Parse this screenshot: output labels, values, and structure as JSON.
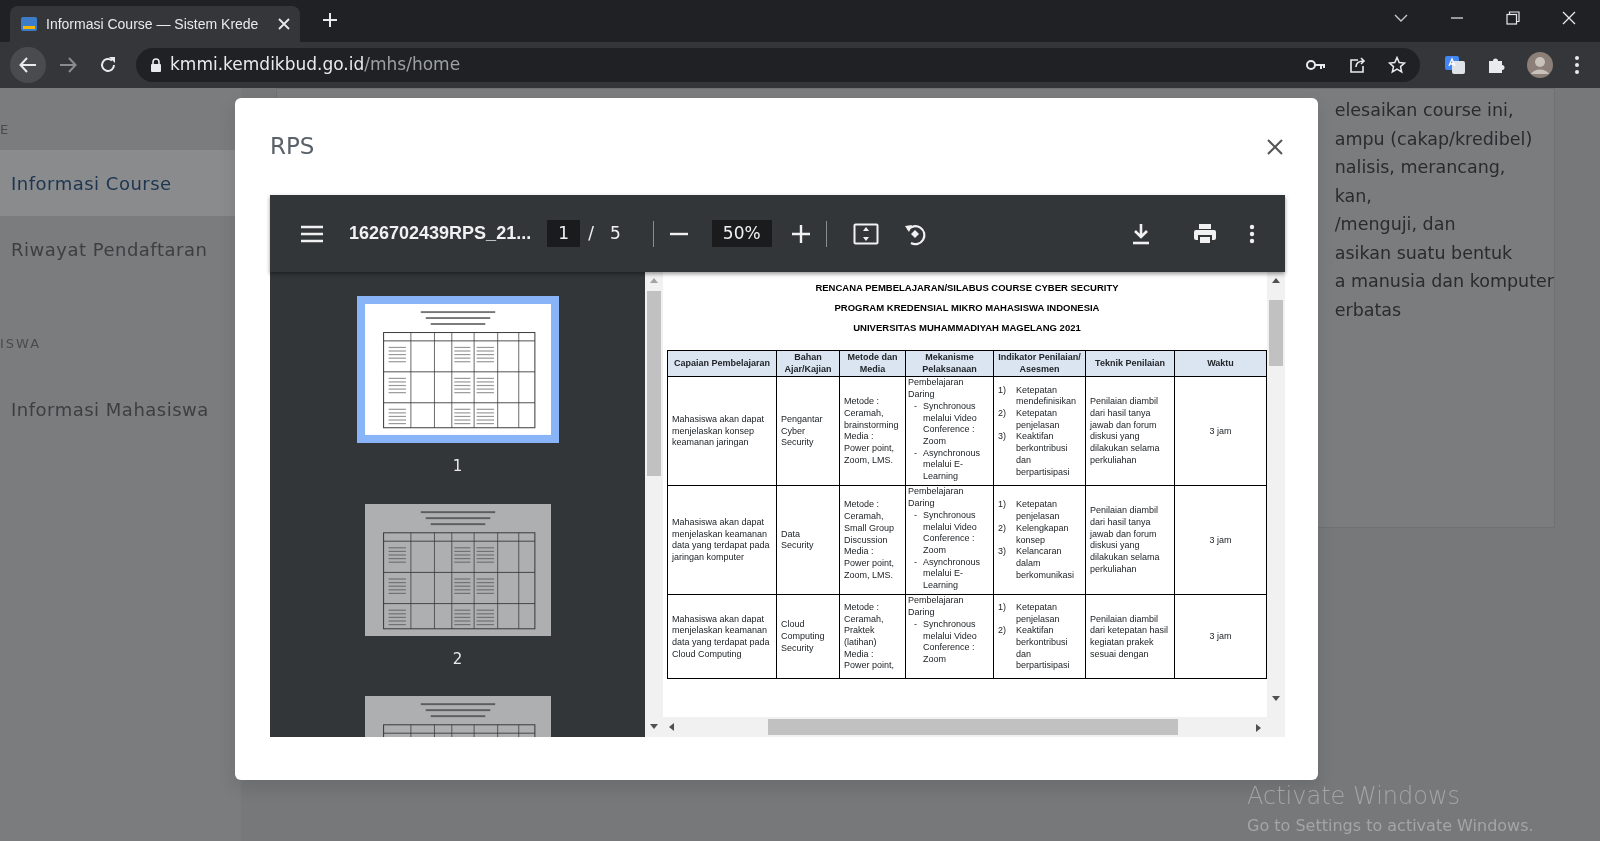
{
  "browser": {
    "tab": {
      "title": "Informasi Course — Sistem Krede",
      "selected": true
    },
    "url": {
      "host": "kmmi.kemdikbud.go.id",
      "path": "/mhs/home"
    }
  },
  "sidebar": {
    "items": [
      {
        "kind": "section",
        "label": "E"
      },
      {
        "kind": "link",
        "label": "Informasi Course",
        "selected": true
      },
      {
        "kind": "link",
        "label": "Riwayat Pendaftaran",
        "selected": false
      },
      {
        "kind": "section",
        "label": "ISWA"
      },
      {
        "kind": "link",
        "label": "Informasi Mahasiswa",
        "selected": false
      }
    ]
  },
  "course_description": {
    "lines": [
      "elesaikan course ini,",
      "ampu (cakap/kredibel)",
      "nalisis, merancang,",
      "kan,",
      "/menguji, dan",
      "asikan suatu bentuk",
      "a manusia dan komputer",
      "erbatas"
    ]
  },
  "modal": {
    "title": "RPS",
    "pdf_viewer": {
      "file_name": "1626702439RPS_21...",
      "page": "1",
      "page_separator": "/",
      "page_count": "5",
      "zoom": "50%",
      "thumbnails": [
        {
          "label": "1",
          "selected": true
        },
        {
          "label": "2",
          "selected": false
        },
        {
          "selected": false
        }
      ],
      "document": {
        "heading_lines": [
          "RENCANA PEMBELAJARAN/SILABUS COURSE CYBER SECURITY",
          "PROGRAM KREDENSIAL MIKRO MAHASISWA INDONESIA",
          "UNIVERSITAS MUHAMMADIYAH MAGELANG 2021"
        ],
        "table": {
          "columns": [
            "Capaian Pembelajaran",
            "Bahan Ajar/Kajian",
            "Metode dan Media",
            "Mekanisme Pelaksanaan",
            "Indikator Penilaian/ Asesmen",
            "Teknik Penilaian",
            "Waktu"
          ],
          "rows": [
            {
              "learning_outcome": "Mahasiswa akan dapat menjelaskan konsep keamanan jaringan",
              "material": "Pengantar Cyber Security",
              "method": [
                "Metode : Ceramah, brainstorming",
                "Media : Power point, Zoom, LMS."
              ],
              "mechanism": {
                "intro": "Pembelajaran Daring",
                "items": [
                  {
                    "marker": "-",
                    "text": "Synchronous melalui Video Conference : Zoom"
                  },
                  {
                    "marker": "-",
                    "text": "Asynchronous melalui E-Learning"
                  }
                ]
              },
              "indicators": [
                {
                  "marker": "1)",
                  "text": "Ketepatan mendefinisikan"
                },
                {
                  "marker": "2)",
                  "text": "Ketepatan penjelasan"
                },
                {
                  "marker": "3)",
                  "text": "Keaktifan berkontribusi dan berpartisipasi"
                }
              ],
              "technique": "Penilaian diambil dari hasil tanya jawab dan forum diskusi yang dilakukan selama perkuliahan",
              "time": "3 jam"
            },
            {
              "learning_outcome": "Mahasiswa akan dapat menjelaskan keamanan data yang terdapat pada jaringan komputer",
              "material": "Data Security",
              "method": [
                "Metode : Ceramah, Small Group Discussion",
                "Media : Power point, Zoom, LMS."
              ],
              "mechanism": {
                "intro": "Pembelajaran Daring",
                "items": [
                  {
                    "marker": "-",
                    "text": "Synchronous melalui Video Conference : Zoom"
                  },
                  {
                    "marker": "-",
                    "text": "Asynchronous melalui E-Learning"
                  }
                ]
              },
              "indicators": [
                {
                  "marker": "1)",
                  "text": "Ketepatan penjelasan"
                },
                {
                  "marker": "2)",
                  "text": "Kelengkapan konsep"
                },
                {
                  "marker": "3)",
                  "text": "Kelancaran dalam berkomunikasi"
                }
              ],
              "technique": "Penilaian diambil dari hasil tanya jawab dan forum diskusi yang dilakukan selama perkuliahan",
              "time": "3 jam"
            },
            {
              "learning_outcome": "Mahasiswa akan dapat menjelaskan keamanan data yang terdapat pada Cloud Computing",
              "material": "Cloud Computing Security",
              "method": [
                "Metode : Ceramah, Praktek (latihan)",
                "Media : Power point,"
              ],
              "mechanism": {
                "intro": "Pembelajaran Daring",
                "items": [
                  {
                    "marker": "-",
                    "text": "Synchronous melalui Video Conference : Zoom"
                  }
                ]
              },
              "indicators": [
                {
                  "marker": "1)",
                  "text": "Ketepatan penjelasan"
                },
                {
                  "marker": "2)",
                  "text": "Keaktifan berkontribusi dan berpartisipasi"
                }
              ],
              "technique": "Penilaian diambil dari ketepatan hasil kegiatan prakek sesuai dengan",
              "time": "3 jam"
            }
          ]
        }
      }
    }
  },
  "os_notice": {
    "title": "Activate Windows",
    "message": "Go to Settings to activate Windows."
  }
}
